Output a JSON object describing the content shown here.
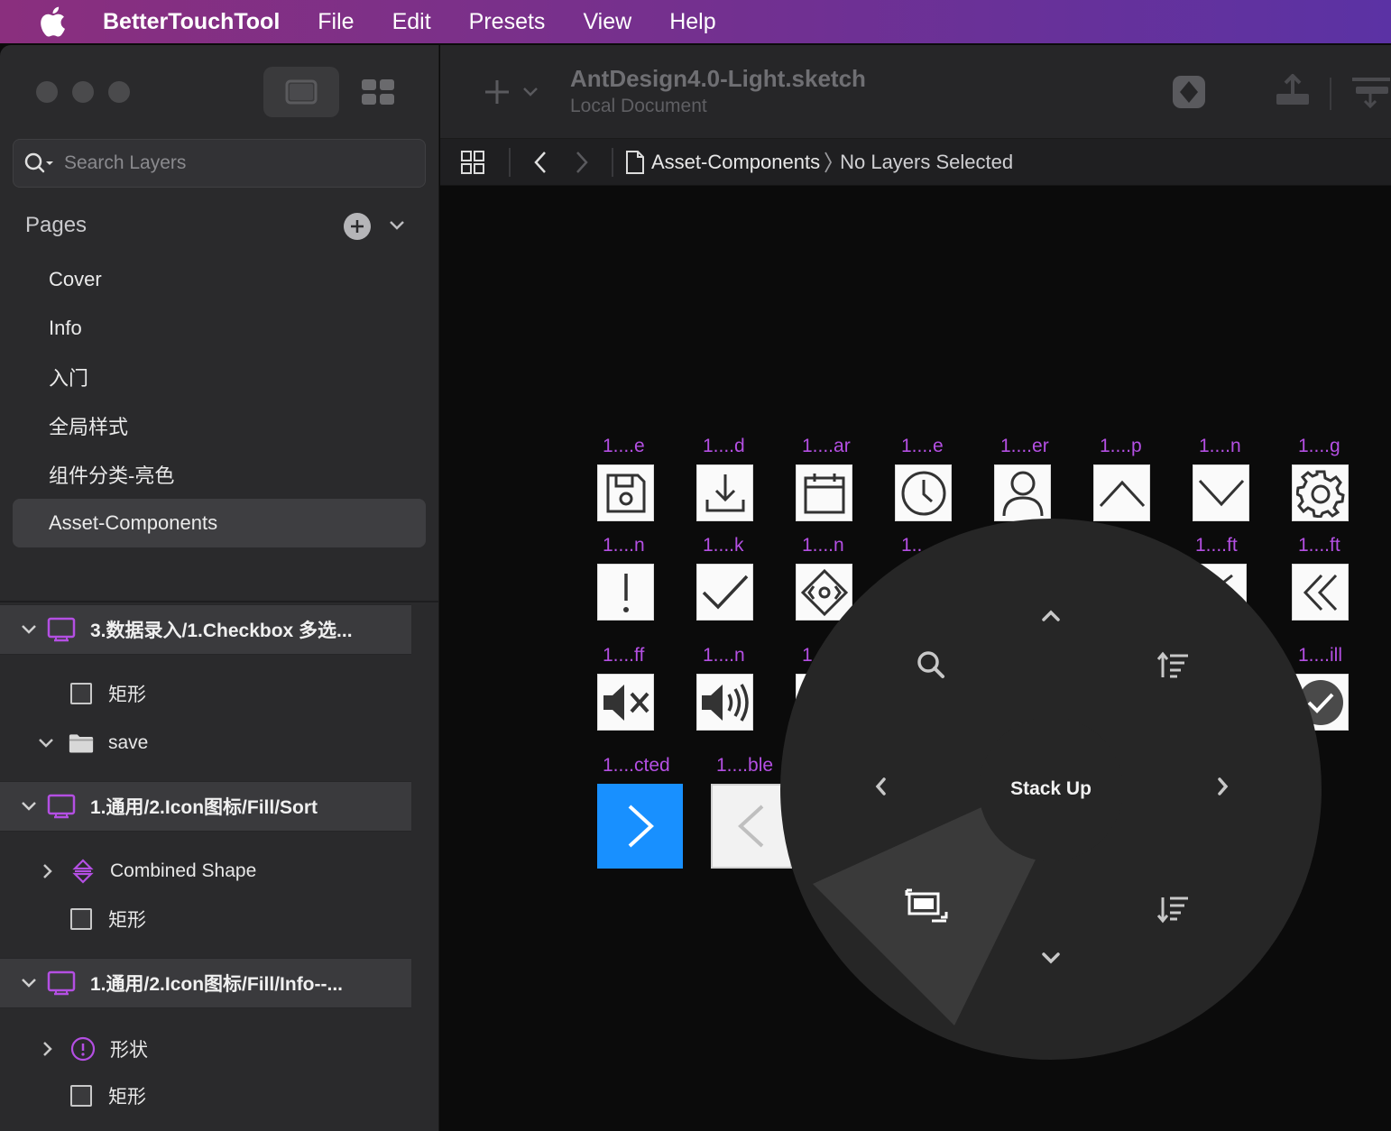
{
  "menubar": {
    "app_name": "BetterTouchTool",
    "menus": [
      "File",
      "Edit",
      "Presets",
      "View",
      "Help"
    ]
  },
  "sidebar": {
    "search_placeholder": "Search Layers",
    "pages_title": "Pages",
    "pages": [
      {
        "label": "Cover",
        "selected": false
      },
      {
        "label": "Info",
        "selected": false
      },
      {
        "label": "入门",
        "selected": false
      },
      {
        "label": "全局样式",
        "selected": false
      },
      {
        "label": "组件分类-亮色",
        "selected": false
      },
      {
        "label": "Asset-Components",
        "selected": true
      }
    ],
    "layer_groups": [
      {
        "title": "3.数据录入/1.Checkbox 多选...",
        "children": [
          {
            "label": "矩形",
            "icon": "rectangle-icon"
          },
          {
            "label": "save",
            "icon": "folder-icon",
            "expanded": true
          }
        ]
      },
      {
        "title": "1.通用/2.Icon图标/Fill/Sort",
        "children": [
          {
            "label": "Combined Shape",
            "icon": "sort-shape-icon",
            "expanded": false
          },
          {
            "label": "矩形",
            "icon": "rectangle-icon"
          }
        ]
      },
      {
        "title": "1.通用/2.Icon图标/Fill/Info--...",
        "children": [
          {
            "label": "形状",
            "icon": "info-shape-icon",
            "expanded": false
          },
          {
            "label": "矩形",
            "icon": "rectangle-icon"
          }
        ]
      }
    ]
  },
  "toolbar": {
    "doc_title": "AntDesign4.0-Light.sketch",
    "doc_subtitle": "Local Document"
  },
  "breadcrumb": {
    "page": "Asset-Components",
    "selection": "No Layers Selected"
  },
  "canvas": {
    "row1_labels": [
      "1....e",
      "1....d",
      "1....ar",
      "1....e",
      "1....er",
      "1....p",
      "1....n",
      "1....g"
    ],
    "row1_icons": [
      "save-icon",
      "download-icon",
      "calendar-icon",
      "clock-icon",
      "user-icon",
      "chevron-up-icon",
      "chevron-down-icon",
      "gear-icon"
    ],
    "row2_labels": [
      "1....n",
      "1....k",
      "1....n",
      "1..",
      "1....ft",
      "1....ft"
    ],
    "row2_icons": [
      "exclamation-icon",
      "check-icon",
      "diamond-arrows-icon",
      "",
      "left-icon",
      "double-left-icon"
    ],
    "row3_labels": [
      "1....ff",
      "1....n",
      "1",
      "1....ill"
    ],
    "row3_icons": [
      "volume-off-icon",
      "volume-on-icon",
      "",
      "check-circle-icon"
    ],
    "row4_labels": [
      "1....cted",
      "1....ble"
    ],
    "row4_icons": [
      "right-selected-icon",
      "left-disabled-icon"
    ],
    "accent_blue": "#1890ff",
    "label_color": "#b44fe3"
  },
  "pie_menu": {
    "center_label": "Stack Up",
    "items": [
      "chevron-up-icon",
      "sort-ascending-icon",
      "chevron-right-icon",
      "sort-descending-icon",
      "chevron-down-icon",
      "window-arrange-icon",
      "chevron-left-icon",
      "magnifier-icon"
    ]
  }
}
